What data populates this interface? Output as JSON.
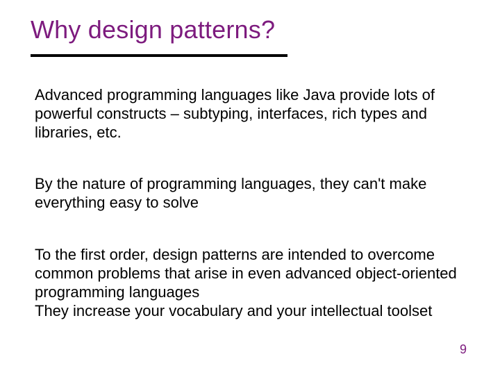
{
  "slide": {
    "title": "Why design patterns?",
    "paragraphs": {
      "p1": "Advanced programming languages like Java provide lots of powerful constructs – subtyping, interfaces, rich types and libraries, etc.",
      "p2": "By the nature of programming languages, they can't make everything easy to solve",
      "p3": "To the first order, design patterns are intended to overcome common problems that arise in even advanced object-oriented programming languages",
      "p4": "They increase your vocabulary and your intellectual toolset"
    },
    "page_number": "9"
  }
}
